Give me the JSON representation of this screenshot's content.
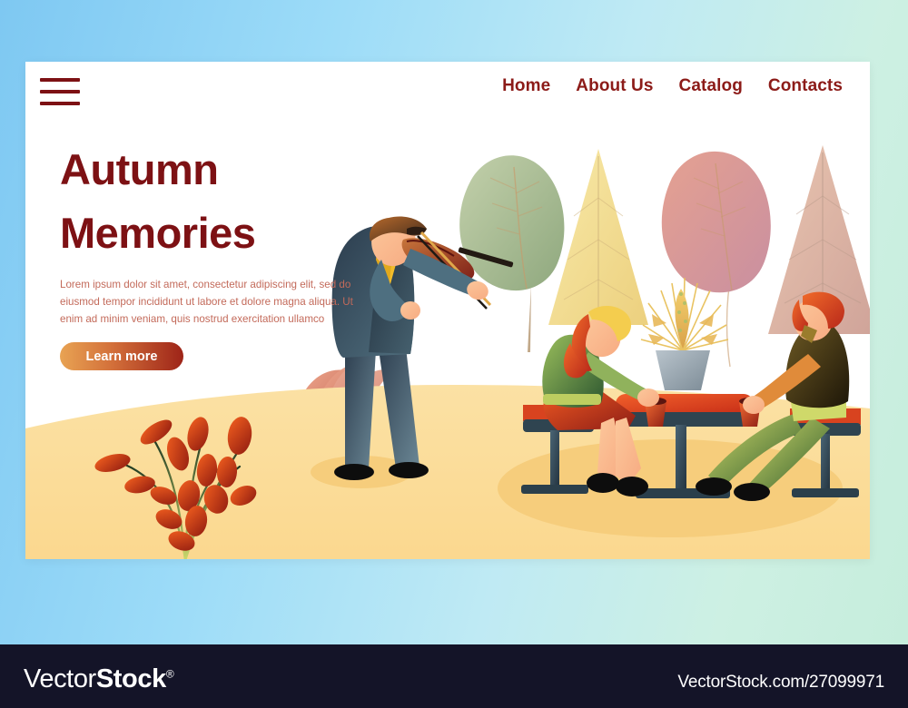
{
  "site": {
    "menu_icon": "hamburger-icon",
    "nav": [
      {
        "label": "Home"
      },
      {
        "label": "About Us"
      },
      {
        "label": "Catalog"
      },
      {
        "label": "Contacts"
      }
    ]
  },
  "hero": {
    "title_line1": "Autumn",
    "title_line2": "Memories",
    "paragraph": "Lorem ipsum dolor sit amet, consectetur adipiscing elit, sed do eiusmod tempor incididunt ut labore et dolore magna aliqua. Ut enim ad minim veniam, quis nostrud exercitation ullamco",
    "cta_label": "Learn more"
  },
  "illustration": {
    "scene_name": "autumn-park-picnic",
    "figures": [
      {
        "name": "violinist",
        "description": "man playing violin, dark teal suit, yellow shirt, brown hair"
      },
      {
        "name": "seated-woman",
        "description": "woman in green sweater and red skirt sitting on stool"
      },
      {
        "name": "seated-man",
        "description": "man in dark olive sweater and green trousers sitting on stool"
      }
    ],
    "props": [
      {
        "name": "picnic-table"
      },
      {
        "name": "potted-plant"
      },
      {
        "name": "red-cup-left"
      },
      {
        "name": "red-cup-right"
      },
      {
        "name": "berry-branch"
      }
    ],
    "trees": [
      {
        "name": "tree-green-blob",
        "color": "#a9bc96"
      },
      {
        "name": "tree-yellow-cone",
        "color": "#f2dd98"
      },
      {
        "name": "tree-rose-blob",
        "color": "#dd9a8e"
      },
      {
        "name": "tree-tan-cone",
        "color": "#dcb6a4"
      }
    ]
  },
  "footer": {
    "logo_light": "Vector",
    "logo_bold": "Stock",
    "logo_mark": "®",
    "url": "VectorStock.com/27099971"
  },
  "colors": {
    "brand_maroon": "#7d1114",
    "nav_red": "#8c1b18",
    "body_text": "#c36a5a",
    "cta_gradient_start": "#e8a353",
    "cta_gradient_end": "#9e2418",
    "bg_blue": "#9ddcf8",
    "ground_sand": "#fbdf9f",
    "footer_bg": "#141428"
  }
}
